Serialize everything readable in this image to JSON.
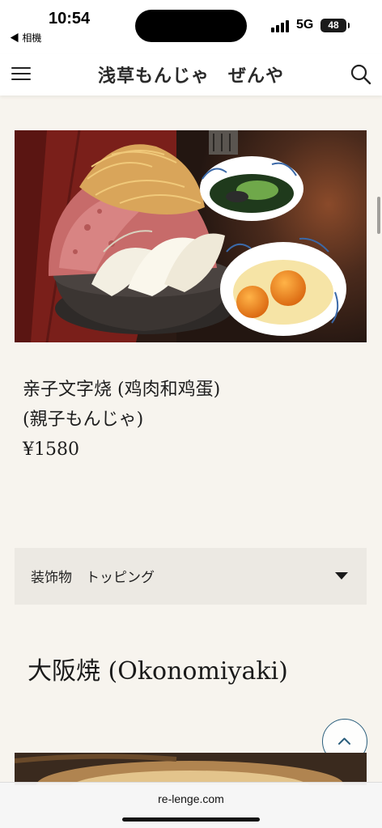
{
  "status_bar": {
    "time": "10:54",
    "back_app": "◀ 相機",
    "network": "5G",
    "battery": "48"
  },
  "header": {
    "title": "浅草もんじゃ　ぜんや"
  },
  "product": {
    "image_alt": "Oyako monja with chicken, onion, fried toppings, green onion and raw eggs",
    "name": "亲子文字烧 (鸡肉和鸡蛋)",
    "subname": "(親子もんじゃ)",
    "price": "¥1580"
  },
  "accordion": {
    "label": "装饰物　トッピング"
  },
  "section": {
    "heading": "大阪焼 (Okonomiyaki)"
  },
  "url_bar": {
    "url": "re-lenge.com"
  },
  "colors": {
    "page_bg": "#f7f4ee",
    "accordion_bg": "#ece9e3",
    "back_to_top_border": "#2b5f7d"
  }
}
